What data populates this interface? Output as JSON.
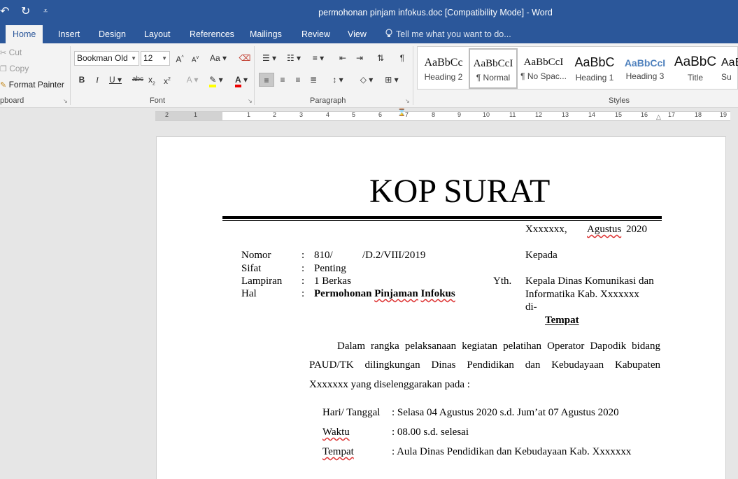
{
  "window": {
    "title": "permohonan pinjam infokus.doc [Compatibility Mode] - Word",
    "qat_undo": "↶",
    "qat_redo": "↻",
    "qat_customize": "⩡"
  },
  "tabs": [
    "Home",
    "Insert",
    "Design",
    "Layout",
    "References",
    "Mailings",
    "Review",
    "View"
  ],
  "tell_me": "Tell me what you want to do...",
  "clipboard": {
    "cut": "Cut",
    "copy": "Copy",
    "format_painter": "Format Painter",
    "label": "pboard"
  },
  "font": {
    "name": "Bookman Old",
    "size": "12",
    "label": "Font"
  },
  "paragraph": {
    "label": "Paragraph"
  },
  "styles": {
    "label": "Styles",
    "items": [
      {
        "preview": "AaBbCc",
        "name": "Heading 2"
      },
      {
        "preview": "AaBbCcI",
        "name": "¶ Normal"
      },
      {
        "preview": "AaBbCcI",
        "name": "¶ No Spac..."
      },
      {
        "preview": "AaBbC",
        "name": "Heading 1"
      },
      {
        "preview": "AaBbCcI",
        "name": "Heading 3"
      },
      {
        "preview": "AaBbC",
        "name": "Title"
      },
      {
        "preview": "AaBb",
        "name": "Su"
      }
    ]
  },
  "ruler": {
    "numbers": [
      "2",
      "1",
      "1",
      "2",
      "3",
      "4",
      "5",
      "6",
      "7",
      "8",
      "9",
      "10",
      "11",
      "12",
      "13",
      "14",
      "15",
      "16",
      "17",
      "18",
      "19"
    ]
  },
  "doc": {
    "kop": "KOP SURAT",
    "place": "Xxxxxxx,",
    "date_month": "Agustus",
    "date_year": "2020",
    "nomor_label": "Nomor",
    "sifat_label": "Sifat",
    "lampiran_label": "Lampiran",
    "hal_label": "Hal",
    "colon": ":",
    "nomor_a": "810/",
    "nomor_b": "/D.2/VIII/2019",
    "sifat_val": "Penting",
    "lampiran_val": "1 Berkas",
    "hal_prefix": "Permohonan",
    "hal_p1": "Pinjaman",
    "hal_p2": "Infokus",
    "kepada": "Kepada",
    "yth": "Yth.",
    "recip_line1": "Kepala Dinas Komunikasi dan",
    "recip_line2": "Informatika Kab. Xxxxxxx",
    "di": "di-",
    "tempat_ul": "Tempat",
    "p1_line1": "Dalam rangka pelaksanaan kegiatan pelatihan Operator Dapodik bidang",
    "p1_line2": "PAUD/TK dilingkungan Dinas Pendidikan dan Kebudayaan Kabupaten",
    "p1_line3": "Xxxxxxx yang diselenggarakan pada :",
    "hari_label": "Hari/ Tanggal",
    "hari_val": ": Selasa 04 Agustus 2020 s.d. Jum’at 07 Agustus 2020",
    "waktu_label": "Waktu",
    "waktu_val": ": 08.00 s.d. selesai",
    "tempat_label": "Tempat",
    "tempat_val": ": Aula Dinas Pendidikan dan Kebudayaan Kab. Xxxxxxx"
  }
}
